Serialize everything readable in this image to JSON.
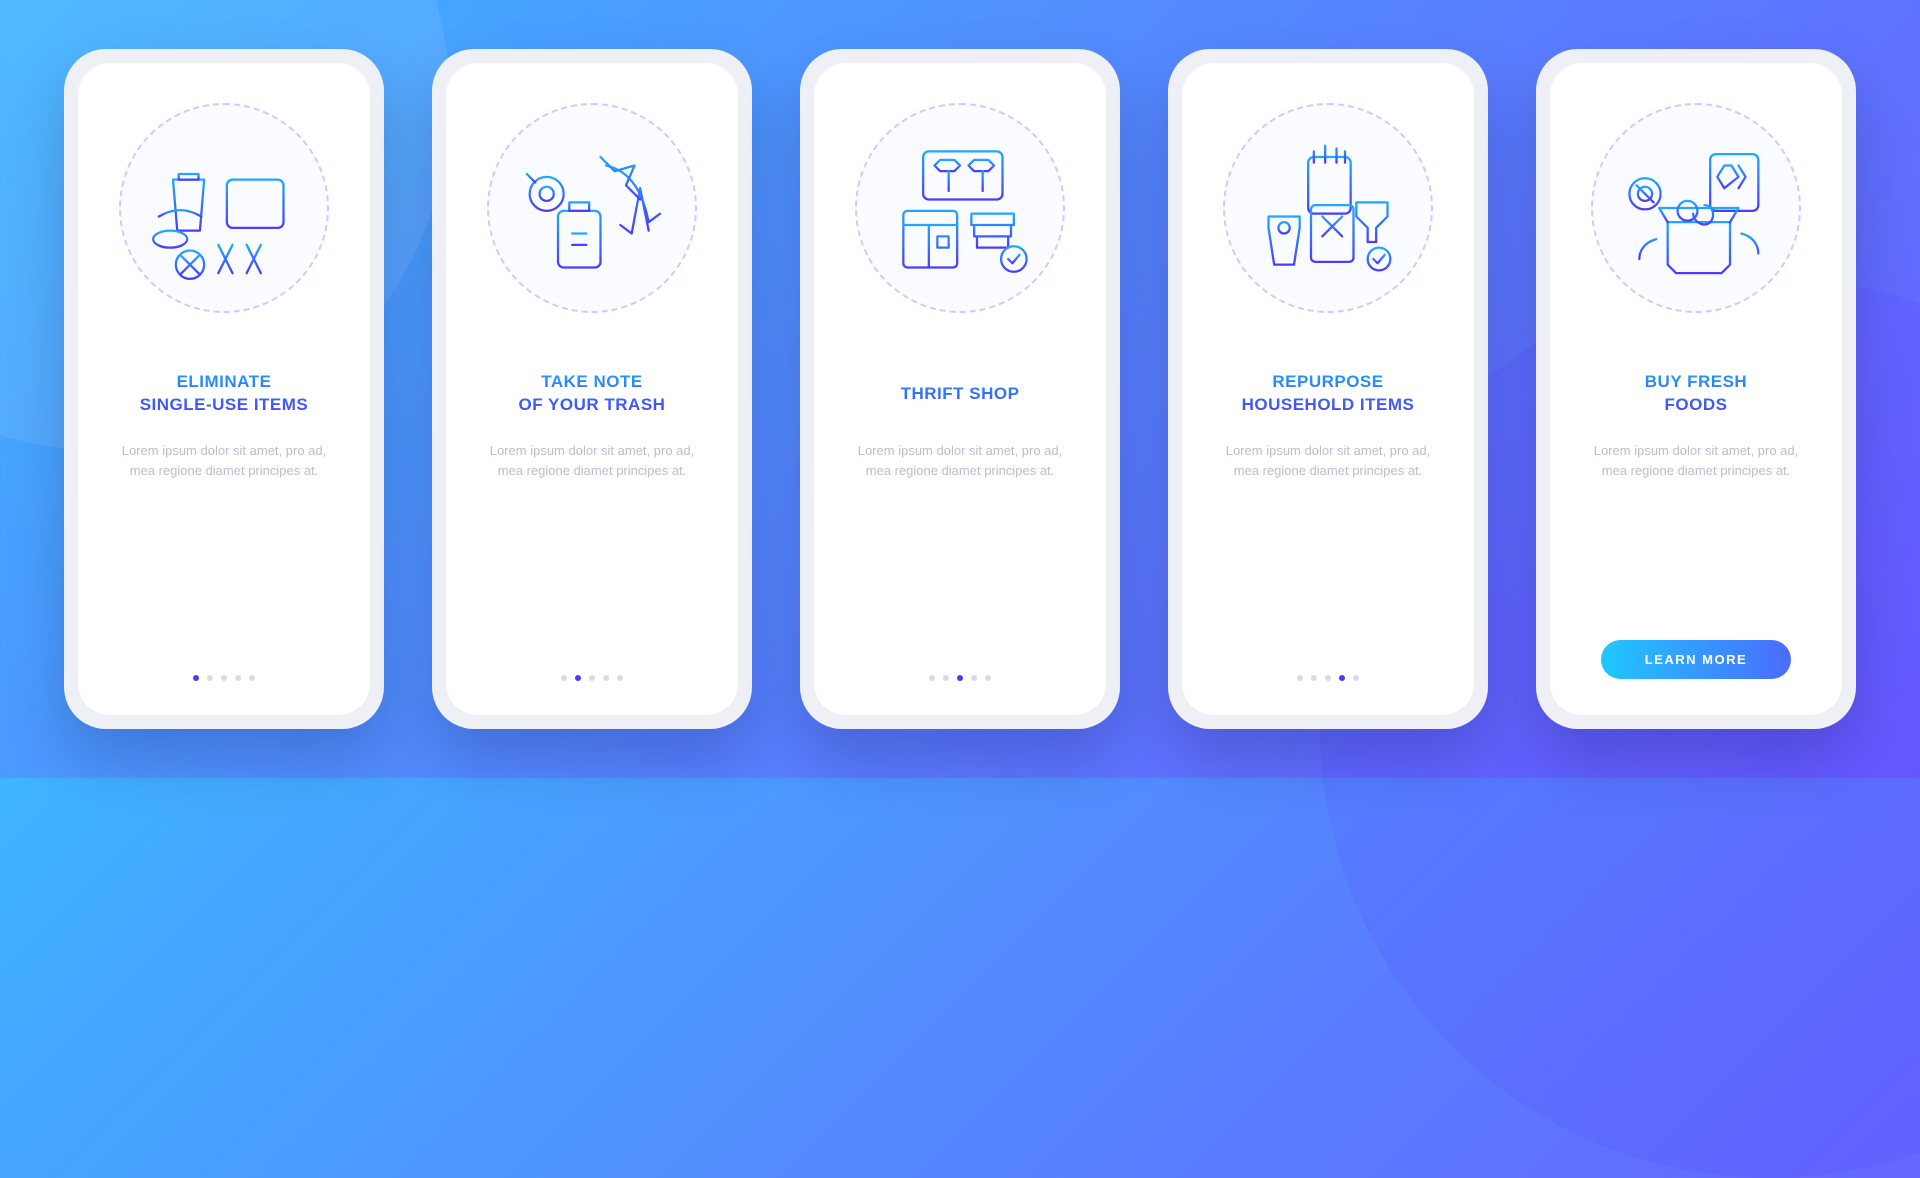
{
  "lorem": "Lorem ipsum dolor sit amet, pro ad, mea regione diamet principes at.",
  "cta_label": "LEARN MORE",
  "screens": [
    {
      "title": "ELIMINATE\nSINGLE-USE ITEMS"
    },
    {
      "title": "TAKE NOTE\nOF YOUR TRASH"
    },
    {
      "title": "THRIFT SHOP"
    },
    {
      "title": "REPURPOSE\nHOUSEHOLD ITEMS"
    },
    {
      "title": "BUY FRESH\nFOODS"
    }
  ]
}
